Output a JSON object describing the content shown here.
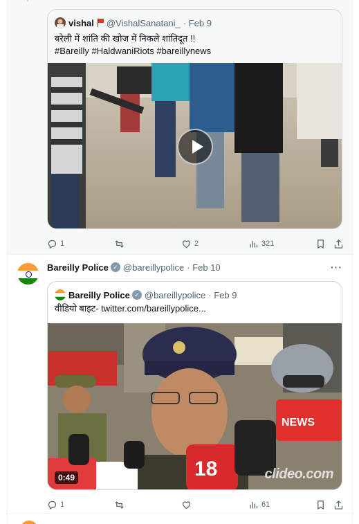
{
  "post1": {
    "quote": {
      "author_name": "vishal",
      "author_handle": "@VishalSanatani_",
      "date": "· Feb 9",
      "text_line1": "बरेली में शांति की खोज में निकले शांतिदूत !!",
      "text_line2": "#Bareilly #HaldwaniRiots #bareillynews"
    },
    "actions": {
      "replies": "1",
      "reposts": "",
      "likes": "2",
      "views": "321"
    }
  },
  "post2": {
    "author_name": "Bareilly Police",
    "author_handle": "@bareillypolice",
    "date": "· Feb 10",
    "quote": {
      "author_name": "Bareilly Police",
      "author_handle": "@bareillypolice",
      "date": "· Feb 9",
      "text": "वीडियो बाइट-  twitter.com/bareillypolice...",
      "video_duration": "0:49",
      "watermark": "clideo.com"
    },
    "actions": {
      "replies": "1",
      "reposts": "",
      "likes": "",
      "views": "61"
    }
  },
  "colors": {
    "text": "#0f1419",
    "muted": "#536471",
    "border": "#cfd9de",
    "thread_bg": "#f7f9f9"
  },
  "icons": [
    "reply-icon",
    "repost-icon",
    "like-icon",
    "views-icon",
    "bookmark-icon",
    "share-icon",
    "play-icon",
    "verified-badge-icon",
    "more-icon",
    "flag-icon"
  ]
}
